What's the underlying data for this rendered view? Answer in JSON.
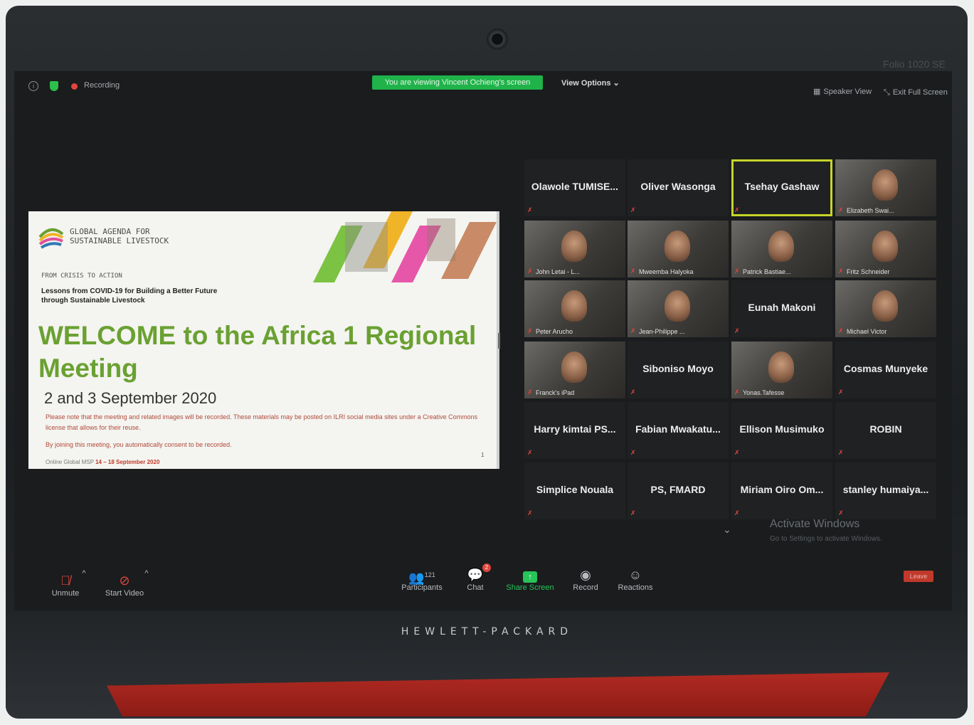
{
  "device": {
    "brand": "HEWLETT-PACKARD",
    "model": "Folio 1020 SE"
  },
  "topbar": {
    "recording_label": "Recording",
    "viewing_banner": "You are viewing Vincent Ochieng's screen",
    "view_options": "View Options",
    "speaker_view": "Speaker View",
    "exit_full_screen": "Exit Full Screen"
  },
  "slide": {
    "org": "GLOBAL AGENDA FOR\nSUSTAINABLE LIVESTOCK",
    "crisis": "FROM CRISIS TO ACTION",
    "lessons": "Lessons from COVID-19 for Building a Better Future\nthrough Sustainable Livestock",
    "welcome": "WELCOME to the Africa 1 Regional Meeting",
    "dates": "2 and 3 September 2020",
    "note": "Please note that the meeting and related images will be recorded. These materials may be posted on ILRI social media sites under a Creative Commons license that allows for their reuse.",
    "consent": "By joining this meeting, you automatically consent to be recorded.",
    "footer_prefix": "Online Global MSP ",
    "footer_dates": "14 – 18 September 2020",
    "page": "1"
  },
  "participants_grid": [
    {
      "name": "Olawole TUMISE...",
      "video": false
    },
    {
      "name": "Oliver Wasonga",
      "video": false
    },
    {
      "name": "Tsehay Gashaw",
      "video": false,
      "active": true
    },
    {
      "name": "Elizabeth Swai...",
      "video": true
    },
    {
      "name": "John Letai - L...",
      "video": true
    },
    {
      "name": "Mweemba Halyoka",
      "video": true
    },
    {
      "name": "Patrick Bastiae...",
      "video": true
    },
    {
      "name": "Fritz Schneider",
      "video": true
    },
    {
      "name": "Peter Arucho",
      "video": true
    },
    {
      "name": "Jean-Philippe ...",
      "video": true
    },
    {
      "name": "Eunah Makoni",
      "video": false
    },
    {
      "name": "Michael Victor",
      "video": true
    },
    {
      "name": "Franck's iPad",
      "video": true
    },
    {
      "name": "Siboniso Moyo",
      "video": false
    },
    {
      "name": "Yonas.Tafesse",
      "video": true
    },
    {
      "name": "Cosmas Munyeke",
      "video": false
    },
    {
      "name": "Harry kimtai PS...",
      "video": false
    },
    {
      "name": "Fabian Mwakatu...",
      "video": false
    },
    {
      "name": "Ellison Musimuko",
      "video": false
    },
    {
      "name": "ROBIN",
      "video": false
    },
    {
      "name": "Simplice Nouala",
      "video": false
    },
    {
      "name": "PS, FMARD",
      "video": false
    },
    {
      "name": "Miriam Oiro Om...",
      "video": false
    },
    {
      "name": "stanley humaiya...",
      "video": false
    }
  ],
  "watermark": {
    "title": "Activate Windows",
    "sub": "Go to Settings to activate Windows."
  },
  "toolbar": {
    "unmute": "Unmute",
    "start_video": "Start Video",
    "participants_count": "121",
    "participants": "Participants",
    "chat": "Chat",
    "chat_badge": "2",
    "share_screen": "Share Screen",
    "record": "Record",
    "reactions": "Reactions",
    "leave": "Leave"
  },
  "colors": {
    "zoom_green": "#1fb34a",
    "active_speaker": "#c7d42a",
    "welcome_green": "#6aa132",
    "mute_red": "#e0463c"
  }
}
